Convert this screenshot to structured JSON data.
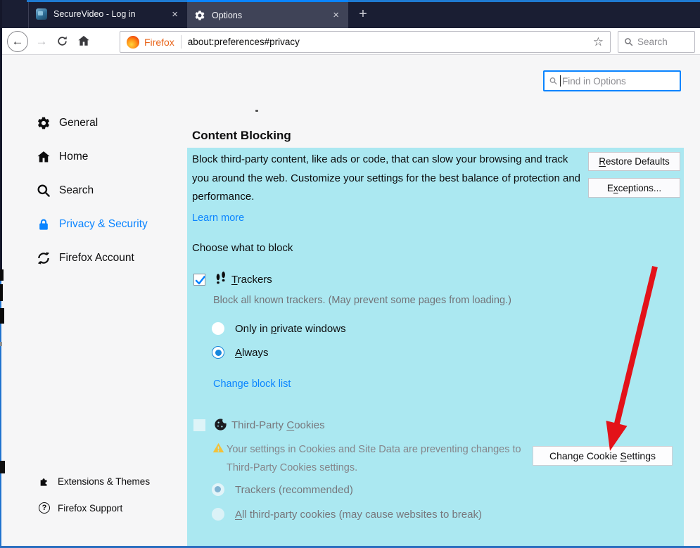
{
  "icons": {
    "close": "×",
    "new_tab": "+",
    "back": "←",
    "forward": "→",
    "star": "☆",
    "help": "?"
  },
  "titlebar": {
    "tabs": [
      {
        "title": "SecureVideo - Log in"
      },
      {
        "title": "Options"
      }
    ]
  },
  "nav": {
    "brand": "Firefox",
    "url": "about:preferences#privacy",
    "search_placeholder": "Search"
  },
  "find": {
    "placeholder": "Find in Options"
  },
  "sidebar": {
    "items": [
      {
        "label": "General"
      },
      {
        "label": "Home"
      },
      {
        "label": "Search"
      },
      {
        "label": "Privacy & Security"
      },
      {
        "label": "Firefox Account"
      }
    ],
    "footer": [
      {
        "label": "Extensions & Themes"
      },
      {
        "label": "Firefox Support"
      }
    ]
  },
  "content": {
    "title": "Content Blocking",
    "intro": "Block third-party content, like ads or code, that can slow your browsing and track you around the web. Customize your settings for the best balance of protection and performance.",
    "learn_more": "Learn more",
    "choose_label": "Choose what to block",
    "buttons": {
      "restore_defaults": {
        "pre": "",
        "key": "R",
        "post": "estore Defaults"
      },
      "exceptions": {
        "pre": "E",
        "key": "x",
        "post": "ceptions..."
      },
      "change_cookie_settings": {
        "pre": "Change Cookie ",
        "key": "S",
        "post": "ettings"
      }
    },
    "trackers": {
      "label": {
        "pre": "",
        "key": "T",
        "post": "rackers"
      },
      "description": "Block all known trackers. (May prevent some pages from loading.)",
      "option_private": {
        "pre": "Only in ",
        "key": "p",
        "post": "rivate windows"
      },
      "option_always": {
        "pre": "",
        "key": "A",
        "post": "lways"
      },
      "change_block_list": "Change block list"
    },
    "third_party": {
      "label": {
        "pre": "Third-Party ",
        "key": "C",
        "post": "ookies"
      },
      "warning": "Your settings in Cookies and Site Data are preventing changes to Third-Party Cookies settings.",
      "option_trackers": "Trackers (recommended)",
      "option_all": {
        "pre": "",
        "key": "A",
        "post": "ll third-party cookies (may cause websites to break)"
      }
    }
  },
  "colors": {
    "titlebar": "#1a1e33",
    "accent_blue": "#0a84ff",
    "highlight_cyan": "#abe8f1",
    "warning_yellow": "#f3c13a",
    "arrow_red": "#e31219",
    "link_blue": "#0a84ff"
  }
}
